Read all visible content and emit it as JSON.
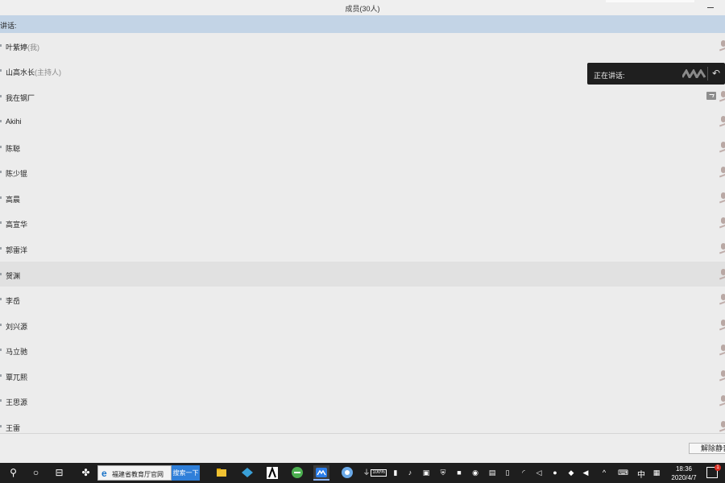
{
  "window": {
    "title": "成员(30人)"
  },
  "speaking_bar": {
    "label": "讲话:"
  },
  "members": [
    {
      "name": "叶紫婷",
      "role": "(我)"
    },
    {
      "name": "山高水长",
      "role": "(主持人)"
    },
    {
      "name": "我在钢厂",
      "role": ""
    },
    {
      "name": "Akihi",
      "role": ""
    },
    {
      "name": "陈聪",
      "role": ""
    },
    {
      "name": "陈少锟",
      "role": ""
    },
    {
      "name": "高晨",
      "role": ""
    },
    {
      "name": "高宣华",
      "role": ""
    },
    {
      "name": "郭雷洋",
      "role": ""
    },
    {
      "name": "贺渊",
      "role": ""
    },
    {
      "name": "李岳",
      "role": ""
    },
    {
      "name": "刘兴源",
      "role": ""
    },
    {
      "name": "马立驰",
      "role": ""
    },
    {
      "name": "覃兀熙",
      "role": ""
    },
    {
      "name": "王思源",
      "role": ""
    },
    {
      "name": "王雷",
      "role": ""
    }
  ],
  "toast": {
    "label": "正在讲话:"
  },
  "footer": {
    "unmute_label": "解除静音"
  },
  "taskbar": {
    "search_value": "福建省教育厅官网",
    "search_button": "搜索一下",
    "battery": "100%",
    "ime": "中",
    "time": "18:36",
    "date": "2020/4/7",
    "notification_count": "1"
  },
  "colors": {
    "speaking_bar": "#c3d4e6",
    "highlight_row": "#e1e1e1",
    "taskbar": "#1e1e1e",
    "search_button": "#2f7fd9"
  }
}
